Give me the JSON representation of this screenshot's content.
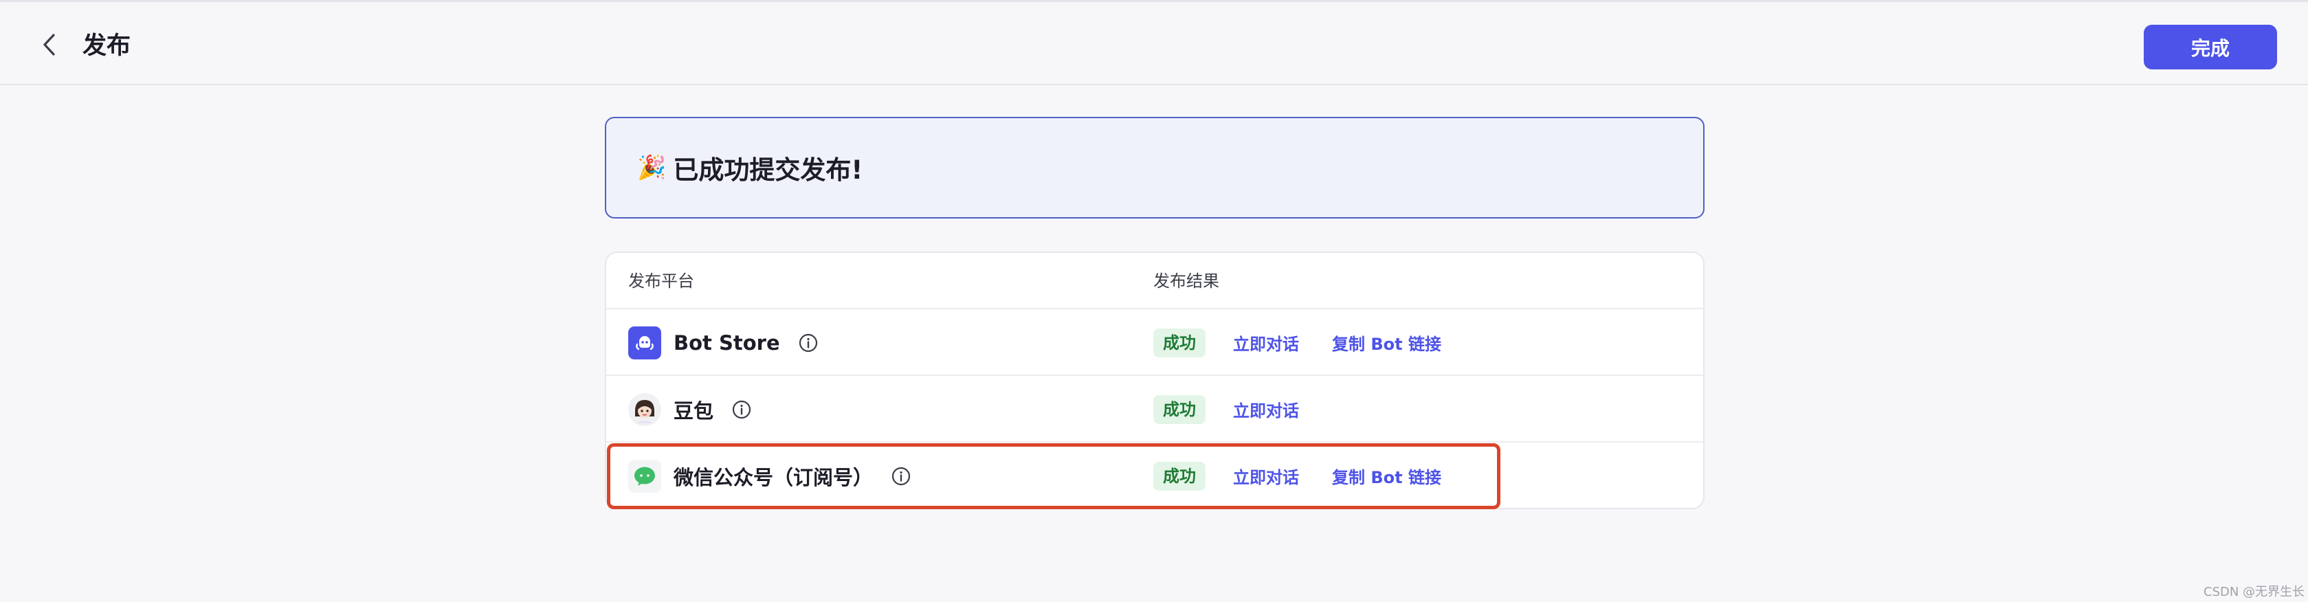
{
  "header": {
    "title": "发布",
    "done_label": "完成",
    "accent_color": "#4d53e8"
  },
  "banner": {
    "emoji": "🎉",
    "message": "已成功提交发布!"
  },
  "table": {
    "columns": [
      "发布平台",
      "发布结果"
    ],
    "rows": [
      {
        "platform": "Bot Store",
        "icon": "bot-store-icon",
        "status": "成功",
        "action1": "立即对话",
        "action2": "复制 Bot 链接"
      },
      {
        "platform": "豆包",
        "icon": "doubao-avatar-icon",
        "status": "成功",
        "action1": "立即对话"
      },
      {
        "platform": "微信公众号（订阅号）",
        "icon": "wechat-icon",
        "status": "成功",
        "action1": "立即对话",
        "action2": "复制 Bot 链接"
      }
    ]
  },
  "watermark": "CSDN @无界生长"
}
